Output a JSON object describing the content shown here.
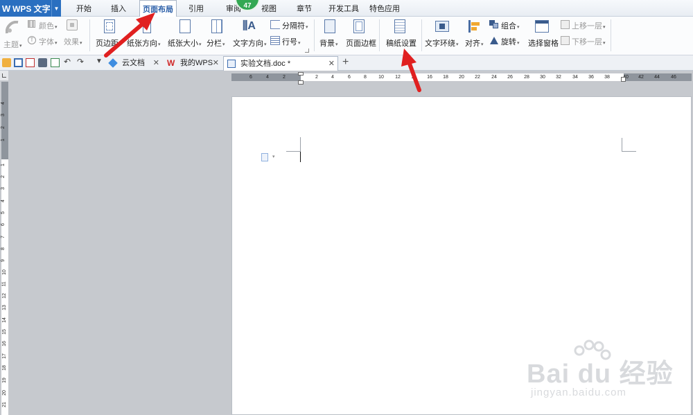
{
  "app": {
    "title": "WPS 文字"
  },
  "menu": {
    "tabs": [
      "开始",
      "插入",
      "页面布局",
      "引用",
      "审阅",
      "视图",
      "章节",
      "开发工具",
      "特色应用"
    ],
    "active": "页面布局",
    "badge": "47"
  },
  "ribbon": {
    "theme": "主题",
    "color": "颜色",
    "font": "字体",
    "effect": "效果",
    "margin": "页边距",
    "orientation": "纸张方向",
    "size": "纸张大小",
    "columns": "分栏",
    "text_direction": "文字方向",
    "break": "分隔符",
    "line_numbers": "行号",
    "background": "背景",
    "page_border": "页面边框",
    "grid_paper": "稿纸设置",
    "wrap": "文字环绕",
    "align": "对齐",
    "group": "组合",
    "rotate": "旋转",
    "selection_pane": "选择窗格",
    "bring_forward": "上移一层",
    "send_backward": "下移一层"
  },
  "doc_tabs": [
    {
      "label": "云文档"
    },
    {
      "label": "我的WPS"
    },
    {
      "label": "实验文档.doc *"
    }
  ],
  "ruler": {
    "h_left": [
      "6",
      "4",
      "2",
      "2"
    ],
    "h_marks": [
      "2",
      "4",
      "6",
      "8",
      "10",
      "12",
      "14",
      "16",
      "18",
      "20",
      "22",
      "24",
      "26",
      "28",
      "30",
      "32",
      "34",
      "36",
      "38",
      "40",
      "42",
      "44",
      "46"
    ],
    "v_top": [
      "4",
      "3",
      "2",
      "1"
    ],
    "v_marks": [
      "1",
      "2",
      "3",
      "4",
      "5",
      "6",
      "7",
      "8",
      "9",
      "10",
      "11",
      "12",
      "13",
      "14",
      "15",
      "16",
      "17",
      "18",
      "19",
      "20",
      "21"
    ]
  },
  "watermark": {
    "main": "Bai du 经验",
    "sub": "jingyan.baidu.com"
  },
  "colors": {
    "accent": "#2a6fc0",
    "badge": "#33a853",
    "arrow": "#e02020"
  }
}
